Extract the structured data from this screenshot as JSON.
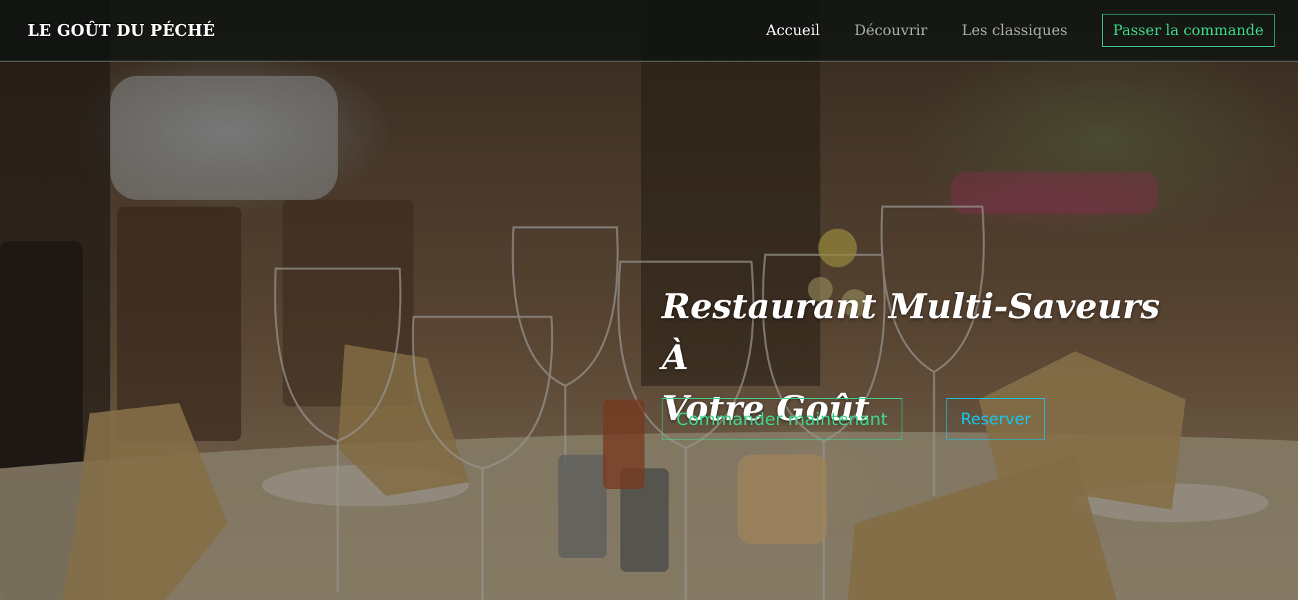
{
  "brand": {
    "name": "LE GOÛT DU PÉCHÉ"
  },
  "nav": {
    "items": [
      {
        "label": "Accueil",
        "active": true
      },
      {
        "label": "Découvrir",
        "active": false
      },
      {
        "label": "Les classiques",
        "active": false
      }
    ],
    "cta_label": "Passer la commande"
  },
  "hero": {
    "title_line1": "Restaurant Multi-Saveurs À",
    "title_line2": "Votre Goût",
    "order_button": "Commander maintenant",
    "reserve_button": "Reserver",
    "background": "restaurant-table-photo"
  },
  "colors": {
    "accent_green": "#3dd68c",
    "accent_blue": "#19c4ea",
    "nav_text_inactive": "#a9aca7",
    "navbar_bg": "#0c1210"
  }
}
